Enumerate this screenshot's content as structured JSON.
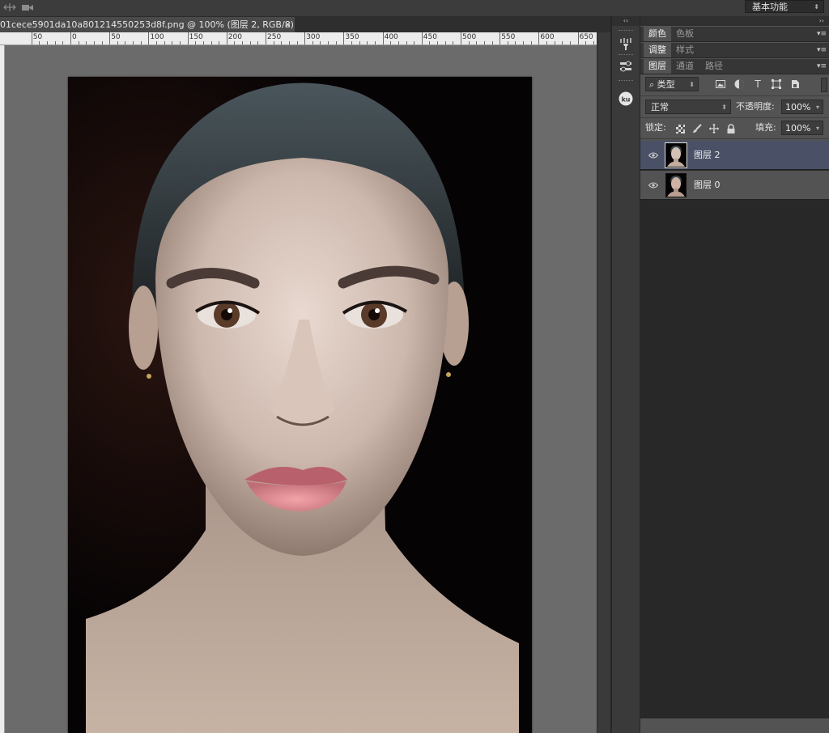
{
  "options_bar": {
    "workspace_label": "基本功能"
  },
  "document": {
    "tab_title": "01cece5901da10a801214550253d8f.png @ 100% (图层 2, RGB/8) *",
    "close_glyph": "×"
  },
  "ruler": {
    "labels": [
      "50",
      "0",
      "50",
      "100",
      "150",
      "200",
      "250",
      "300",
      "350",
      "400",
      "450",
      "500",
      "550",
      "600",
      "650"
    ]
  },
  "panels": {
    "color_group": {
      "tabs": [
        "颜色",
        "色板"
      ]
    },
    "adjust_group": {
      "tabs": [
        "调整",
        "样式"
      ]
    },
    "layers_group": {
      "tabs": [
        "图层",
        "通道",
        "路径"
      ]
    },
    "layers": {
      "filter_label": "类型",
      "blend_mode": "正常",
      "opacity_label": "不透明度:",
      "opacity_value": "100%",
      "lock_label": "锁定:",
      "fill_label": "填充:",
      "fill_value": "100%",
      "items": [
        {
          "name": "图层 2",
          "selected": true,
          "visible": true
        },
        {
          "name": "图层 0",
          "selected": false,
          "visible": true
        }
      ]
    }
  },
  "icons": {
    "filter": [
      "image-filter-icon",
      "adjustment-filter-icon",
      "type-filter-icon",
      "shape-filter-icon",
      "smart-object-filter-icon"
    ],
    "lock": [
      "lock-transparent-icon",
      "lock-image-icon",
      "lock-position-icon",
      "lock-all-icon"
    ]
  },
  "colors": {
    "selected_layer": "#4a5166",
    "panel_bg": "#535353",
    "canvas_bg": "#6b6b6b"
  }
}
